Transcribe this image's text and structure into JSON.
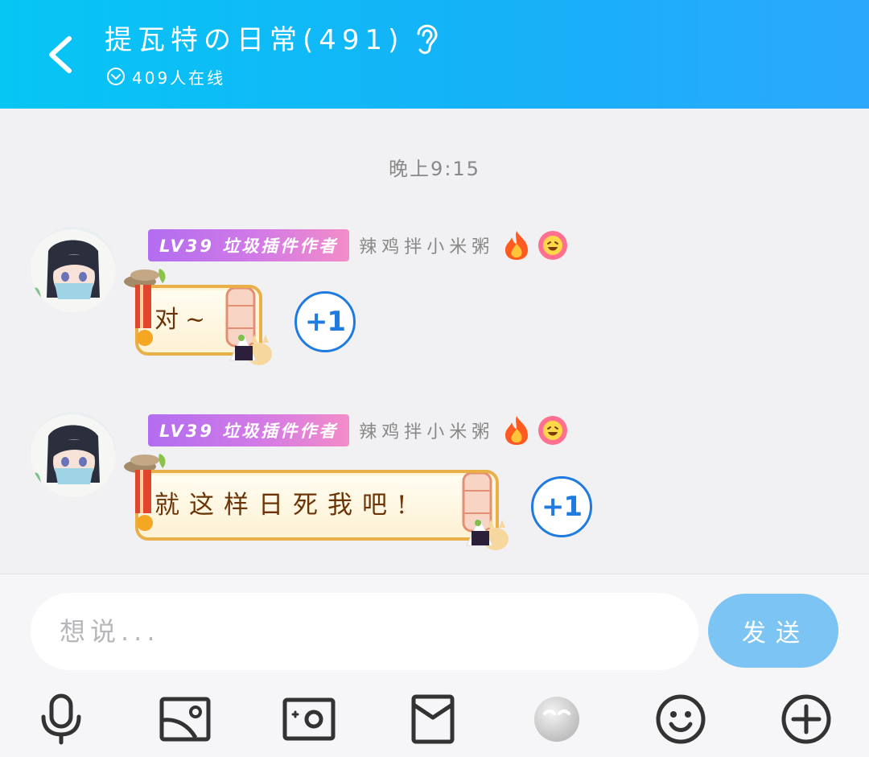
{
  "header": {
    "title": "提瓦特の日常(491)",
    "online": "409人在线"
  },
  "chat": {
    "timestamp": "晚上9:15",
    "messages": [
      {
        "badge": "LV39 垃圾插件作者",
        "nickname": "辣鸡拌小米粥",
        "text": "对~",
        "plus_one": "+1"
      },
      {
        "badge": "LV39 垃圾插件作者",
        "nickname": "辣鸡拌小米粥",
        "text": "就这样日死我吧!",
        "plus_one": "+1"
      }
    ]
  },
  "input": {
    "placeholder": "想说...",
    "send_label": "发送"
  },
  "toolbar": {
    "icons": [
      "microphone-icon",
      "image-icon",
      "camera-icon",
      "red-packet-icon",
      "emoji-sticker-icon",
      "smiley-icon",
      "plus-circle-icon"
    ]
  },
  "colors": {
    "header_gradient_start": "#06c6f4",
    "header_gradient_end": "#2ba8fb",
    "badge_start": "#b26df0",
    "badge_end": "#f38cc9",
    "plus_one": "#1f7be0",
    "send_button": "#7cc4f4",
    "bubble_text": "#6b3508"
  }
}
